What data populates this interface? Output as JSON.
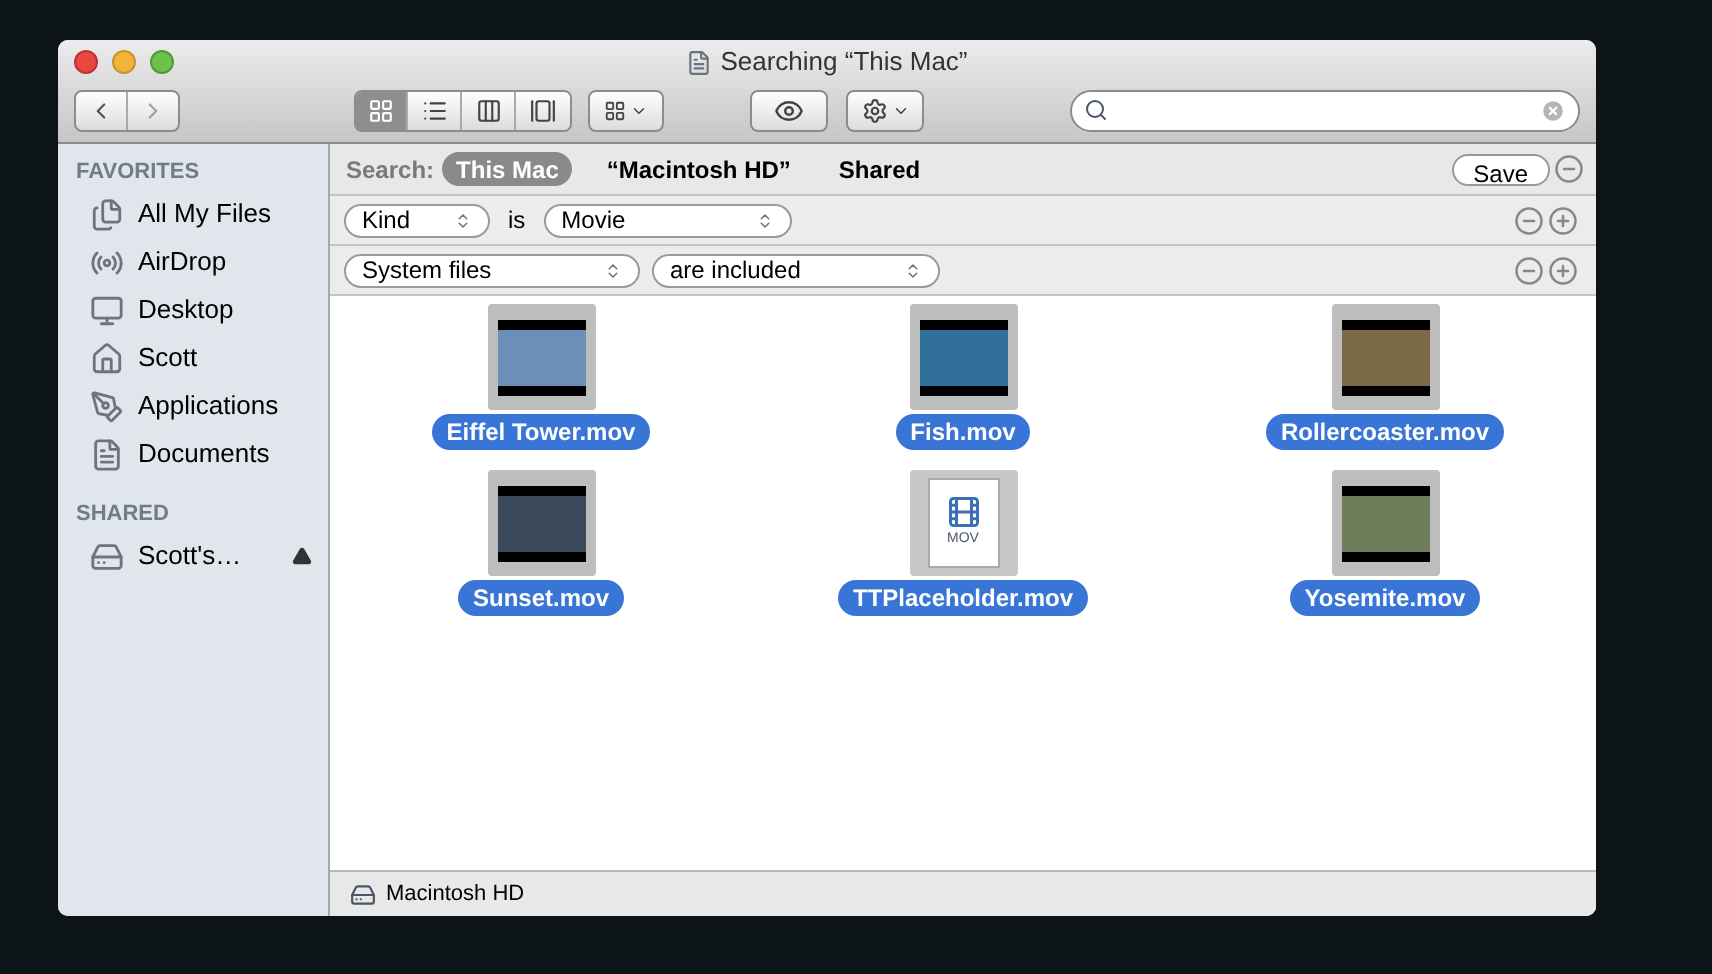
{
  "window": {
    "title": "Searching “This Mac”"
  },
  "toolbar": {
    "view_buttons": [
      {
        "kind": "icon",
        "selected": true
      },
      {
        "kind": "list",
        "selected": false
      },
      {
        "kind": "columns",
        "selected": false
      },
      {
        "kind": "coverflow",
        "selected": false
      }
    ]
  },
  "sidebar": {
    "sections": [
      {
        "heading": "FAVORITES",
        "items": [
          {
            "label": "All My Files",
            "kind": "files"
          },
          {
            "label": "AirDrop",
            "kind": "airdrop"
          },
          {
            "label": "Desktop",
            "kind": "desktop"
          },
          {
            "label": "Scott",
            "kind": "home"
          },
          {
            "label": "Applications",
            "kind": "apps"
          },
          {
            "label": "Documents",
            "kind": "docs"
          }
        ]
      },
      {
        "heading": "SHARED",
        "items": [
          {
            "label": "Scott's…",
            "kind": "server",
            "ejectable": true
          }
        ]
      }
    ]
  },
  "search_bar": {
    "label": "Search:",
    "scopes": [
      {
        "label": "This Mac",
        "selected": true
      },
      {
        "label": "“Macintosh HD”",
        "selected": false
      },
      {
        "label": "Shared",
        "selected": false
      }
    ],
    "save": "Save"
  },
  "criteria": [
    {
      "attribute": "Kind",
      "connector": "is",
      "value": "Movie"
    },
    {
      "attribute": "System files",
      "value": "are included"
    }
  ],
  "files": [
    {
      "name": "Eiffel Tower.mov",
      "kind": "video",
      "color": "#6a8fb8",
      "selected": true
    },
    {
      "name": "Fish.mov",
      "kind": "video",
      "color": "#2f6f9a",
      "selected": true
    },
    {
      "name": "Rollercoaster.mov",
      "kind": "video",
      "color": "#7a6a45",
      "selected": true
    },
    {
      "name": "Sunset.mov",
      "kind": "video",
      "color": "#3a4a5a",
      "selected": true
    },
    {
      "name": "TTPlaceholder.mov",
      "kind": "document",
      "badge": "MOV",
      "selected": true
    },
    {
      "name": "Yosemite.mov",
      "kind": "video",
      "color": "#6f7e5a",
      "selected": true
    }
  ],
  "status_bar": {
    "path": "Macintosh HD"
  }
}
